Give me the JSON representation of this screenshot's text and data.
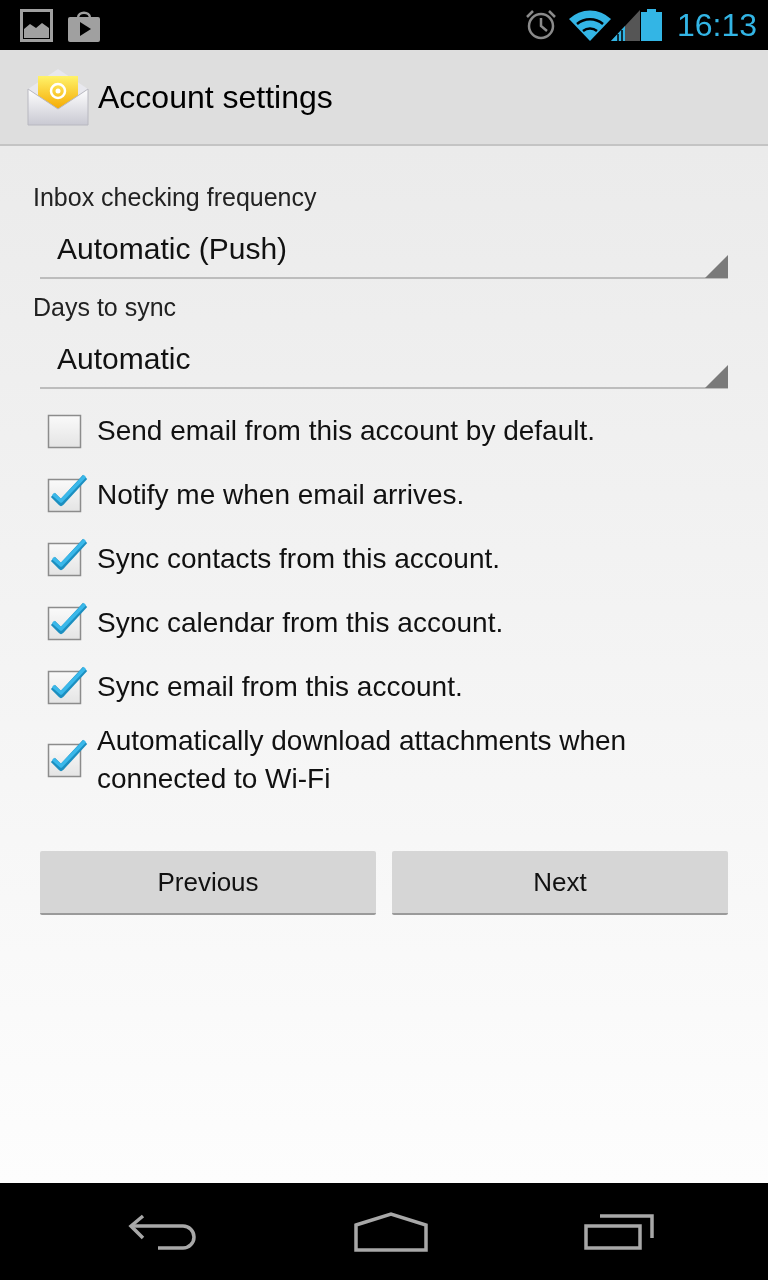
{
  "status_bar": {
    "time": "16:13"
  },
  "action_bar": {
    "title": "Account settings"
  },
  "spinners": [
    {
      "label": "Inbox checking frequency",
      "value": "Automatic (Push)"
    },
    {
      "label": "Days to sync",
      "value": "Automatic"
    }
  ],
  "checkboxes": [
    {
      "label": "Send email from this account by default.",
      "checked": false
    },
    {
      "label": "Notify me when email arrives.",
      "checked": true
    },
    {
      "label": "Sync contacts from this account.",
      "checked": true
    },
    {
      "label": "Sync calendar from this account.",
      "checked": true
    },
    {
      "label": "Sync email from this account.",
      "checked": true
    },
    {
      "label": "Automatically download attachments when connected to Wi-Fi",
      "checked": true
    }
  ],
  "buttons": [
    "Previous",
    "Next"
  ]
}
